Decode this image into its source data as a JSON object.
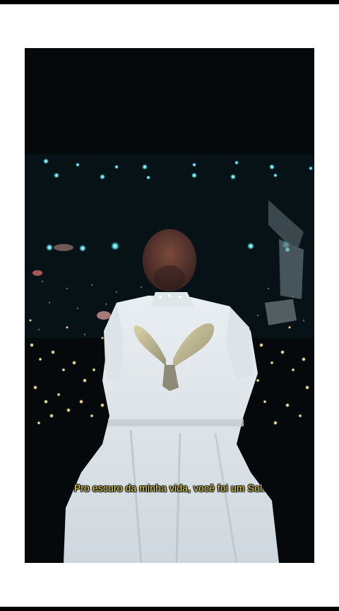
{
  "video": {
    "subtitle": "Pro escuro da minha vida, você foi um Sol."
  },
  "colors": {
    "subtitle": "#f2e24a",
    "background": "#ffffff",
    "scene_dark": "#04090d",
    "stage_lights": "#3fd6e8"
  }
}
